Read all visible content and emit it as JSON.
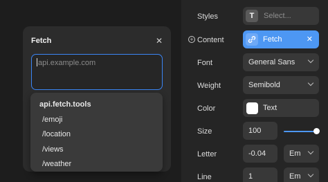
{
  "fetch_panel": {
    "title": "Fetch",
    "input_placeholder": "api.example.com",
    "suggestions": [
      {
        "label": "api.fetch.tools",
        "kind": "head"
      },
      {
        "label": "/emoji",
        "kind": "sub"
      },
      {
        "label": "/location",
        "kind": "sub"
      },
      {
        "label": "/views",
        "kind": "sub"
      },
      {
        "label": "/weather",
        "kind": "sub"
      }
    ]
  },
  "properties": {
    "styles": {
      "label": "Styles",
      "value": "Select...",
      "icon": "T"
    },
    "content": {
      "label": "Content",
      "value": "Fetch"
    },
    "font": {
      "label": "Font",
      "value": "General Sans"
    },
    "weight": {
      "label": "Weight",
      "value": "Semibold"
    },
    "color": {
      "label": "Color",
      "value": "Text"
    },
    "size": {
      "label": "Size",
      "value": "100"
    },
    "letter": {
      "label": "Letter",
      "value": "-0.04",
      "unit": "Em"
    },
    "line": {
      "label": "Line",
      "value": "1",
      "unit": "Em"
    }
  },
  "colors": {
    "accent": "#4d97f3",
    "background": "#1e1e1e",
    "panel": "#2c2c2c"
  }
}
